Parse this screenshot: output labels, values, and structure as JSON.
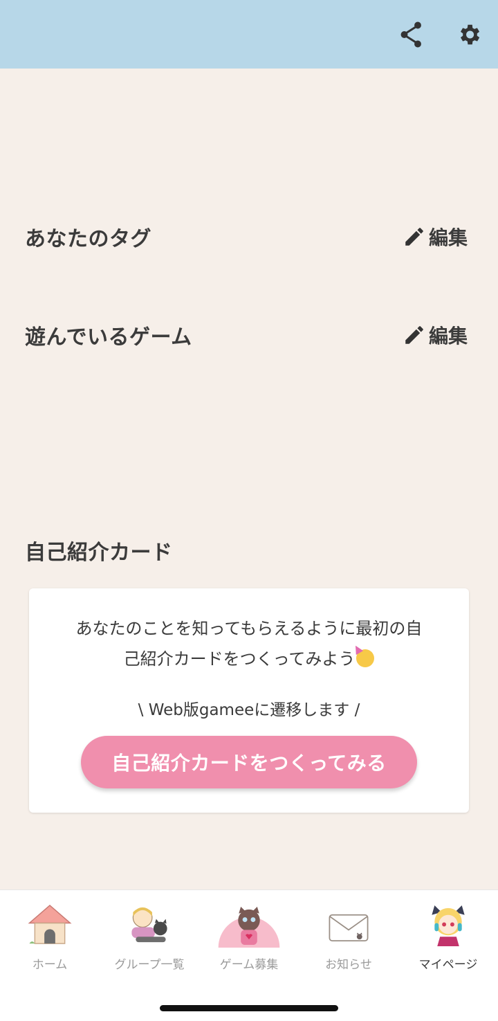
{
  "header": {
    "share_icon": "share-icon",
    "settings_icon": "gear-icon",
    "background": "#b7d7e8"
  },
  "sections": {
    "tags": {
      "title": "あなたのタグ",
      "edit_label": "編集"
    },
    "games": {
      "title": "遊んでいるゲーム",
      "edit_label": "編集"
    },
    "intro_card": {
      "title": "自己紹介カード"
    }
  },
  "intro_card": {
    "message_line1": "あなたのことを知ってもらえるように最初の自",
    "message_line2": "己紹介カードをつくってみよう",
    "redirect_note": "\\ Web版gameeに遷移します /",
    "cta_label": "自己紹介カードをつくってみる",
    "cta_color": "#f08fad"
  },
  "tabbar": {
    "items": [
      {
        "label": "ホーム",
        "icon": "home-icon"
      },
      {
        "label": "グループ一覧",
        "icon": "group-icon"
      },
      {
        "label": "ゲーム募集",
        "icon": "recruit-icon"
      },
      {
        "label": "お知らせ",
        "icon": "mail-icon"
      },
      {
        "label": "マイページ",
        "icon": "avatar-icon",
        "active": true
      }
    ]
  }
}
